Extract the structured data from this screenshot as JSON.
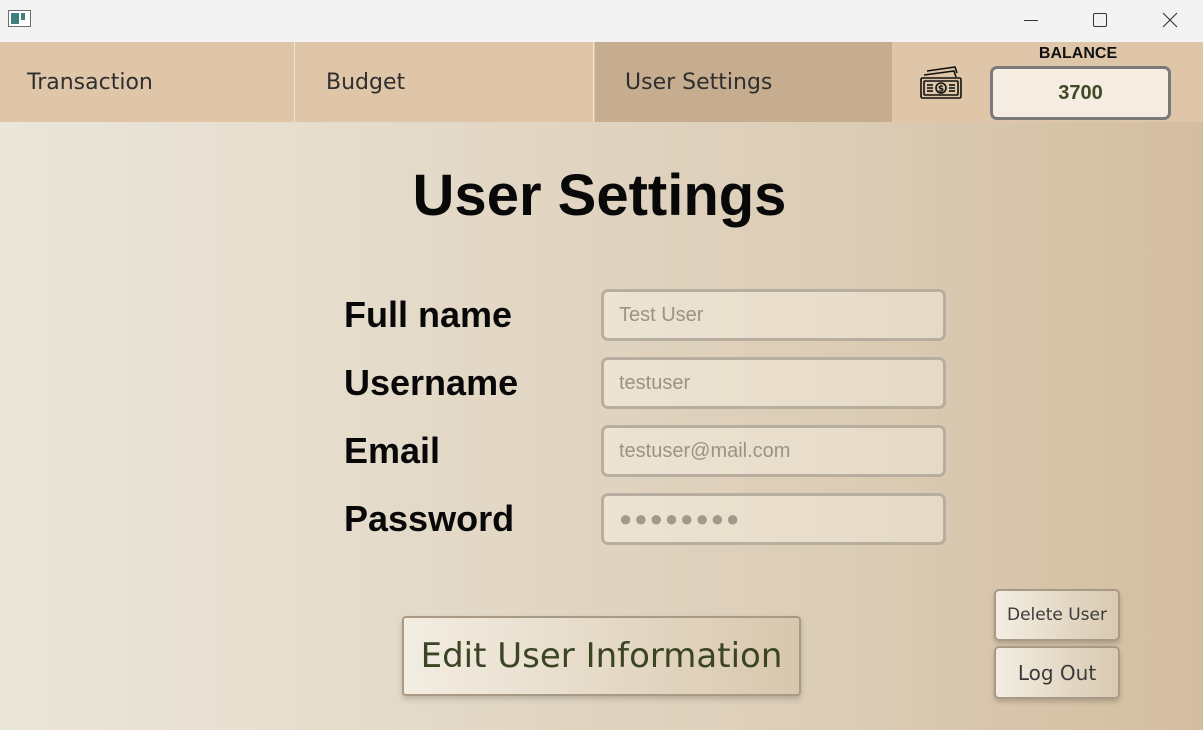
{
  "window": {
    "title_icon": "app-window-icon",
    "controls": [
      "minimize-icon",
      "maximize-icon",
      "close-icon"
    ]
  },
  "nav": {
    "tabs": [
      {
        "label": "Transaction",
        "active": false
      },
      {
        "label": "Budget",
        "active": false
      },
      {
        "label": "User Settings",
        "active": true
      }
    ],
    "money_icon": "money-bill-icon",
    "balance_label": "BALANCE",
    "balance_value": "3700"
  },
  "main": {
    "title": "User Settings",
    "fields": [
      {
        "label": "Full name",
        "placeholder": "Test User"
      },
      {
        "label": "Username",
        "placeholder": "testuser"
      },
      {
        "label": "Email",
        "placeholder": "testuser@mail.com"
      },
      {
        "label": "Password",
        "placeholder": "●●●●●●●●"
      }
    ],
    "edit_button": "Edit User Information",
    "delete_button": "Delete User",
    "logout_button": "Log Out"
  },
  "colors": {
    "nav_bg": "#dfc6a9",
    "active_tab_bg": "#c6ad90",
    "balance_text": "#3e4a24",
    "button_text": "#3b4523"
  }
}
